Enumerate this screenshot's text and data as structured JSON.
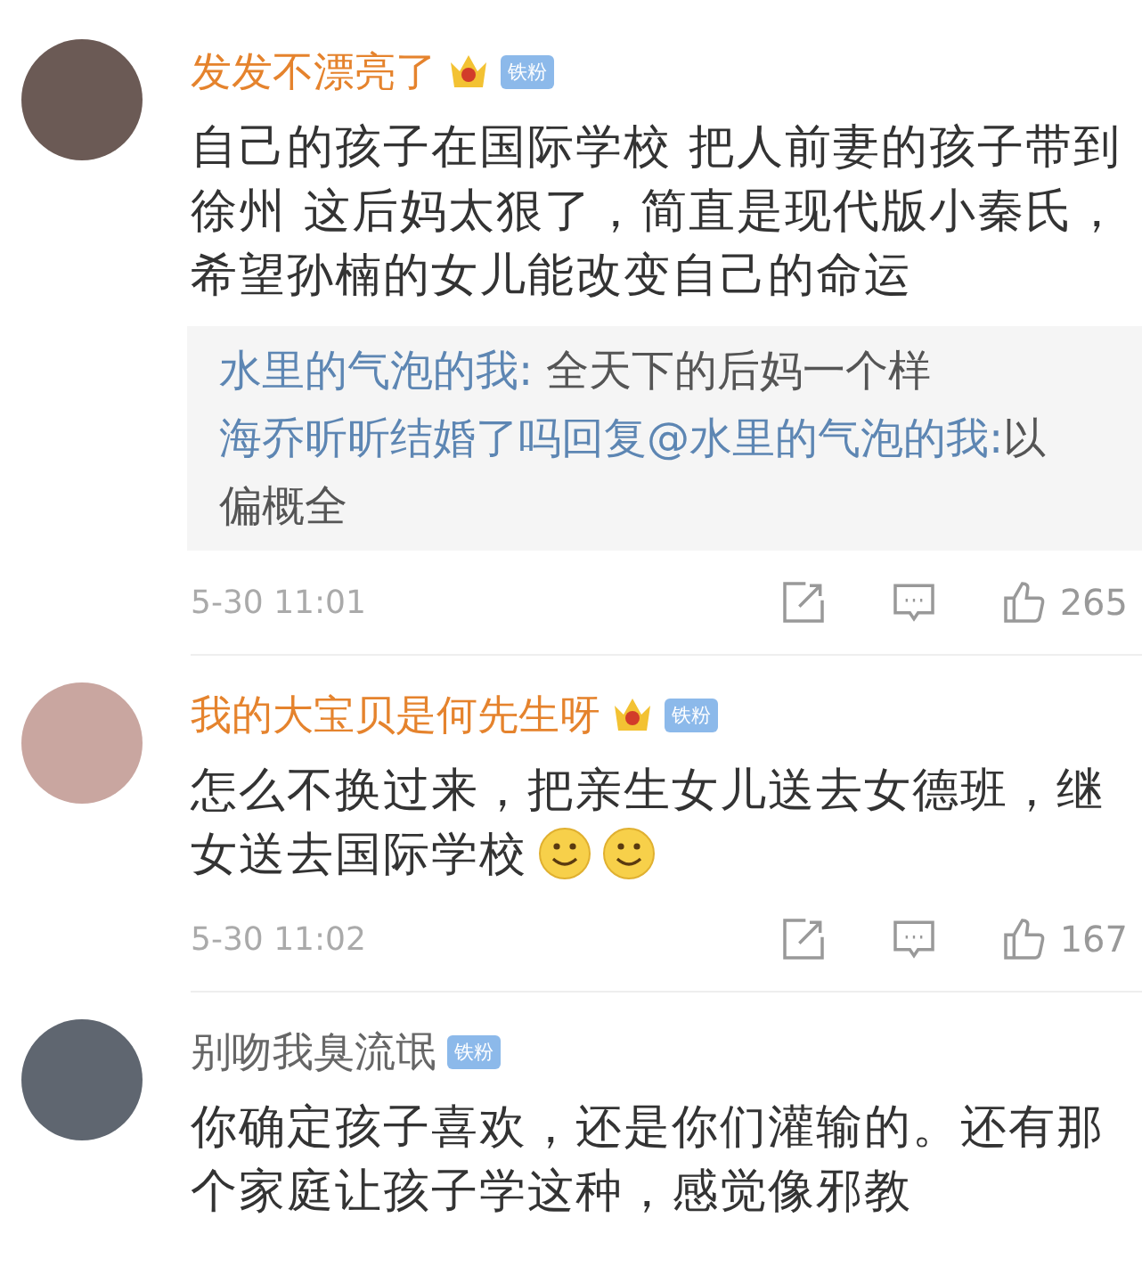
{
  "comments": [
    {
      "user": {
        "name": "发发不漂亮了",
        "vip": true,
        "badge": "铁粉"
      },
      "text": "自己的孩子在国际学校 把人前妻的孩子带到徐州 这后妈太狠了，简直是现代版小秦氏，希望孙楠的女儿能改变自己的命运",
      "replies": [
        {
          "author": "水里的气泡的我:",
          "text": " 全天下的后妈一个样"
        },
        {
          "author": "海乔昕昕结婚了吗回复@水里的气泡的我:",
          "text": "以偏概全"
        }
      ],
      "footer": {
        "time": "5-30 11:01",
        "likes": "265"
      }
    },
    {
      "user": {
        "name": "我的大宝贝是何先生呀",
        "vip": true,
        "badge": "铁粉"
      },
      "lines": [
        "怎么不换过来，把亲生女儿送去女德班，继",
        "女送去国际学校"
      ],
      "emojis": [
        {
          "kind": "smiley"
        },
        {
          "kind": "smiley"
        }
      ],
      "footer": {
        "time": "5-30 11:02",
        "likes": "167"
      }
    },
    {
      "user": {
        "name": "别吻我臭流氓",
        "vip": false,
        "badge": "铁粉"
      },
      "text": "你确定孩子喜欢，还是你们灌输的。还有那个家庭让孩子学这种，感觉像邪教"
    }
  ]
}
